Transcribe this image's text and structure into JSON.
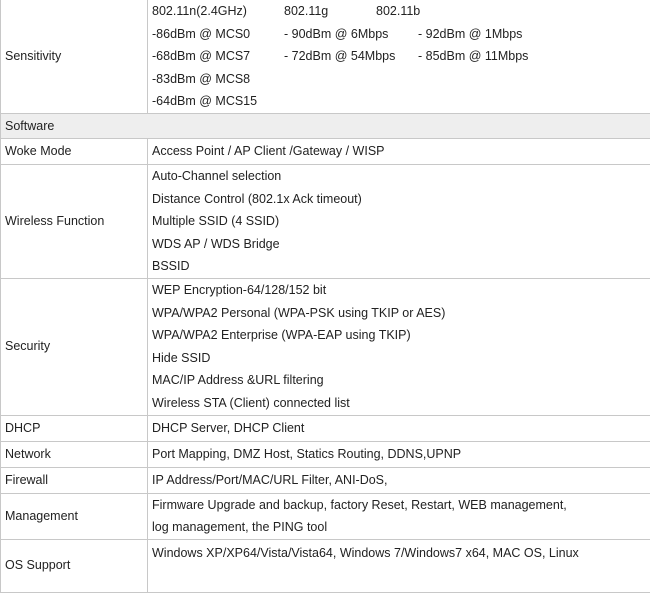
{
  "rows": {
    "sensitivity": {
      "label": "Sensitivity",
      "header": [
        "802.11n(2.4GHz)",
        "802.11g",
        "802.11b"
      ],
      "lines": [
        [
          "-86dBm @ MCS0",
          "- 90dBm @ 6Mbps",
          "- 92dBm @ 1Mbps"
        ],
        [
          "-68dBm @ MCS7",
          "- 72dBm @ 54Mbps",
          "- 85dBm @ 11Mbps"
        ],
        [
          "-83dBm @ MCS8",
          "",
          ""
        ],
        [
          "-64dBm @ MCS15",
          "",
          ""
        ]
      ]
    },
    "software": {
      "label": "Software"
    },
    "work_mode": {
      "label": "Woke Mode",
      "value": "Access Point / AP Client /Gateway / WISP"
    },
    "wireless_function": {
      "label": "Wireless Function",
      "items": [
        "Auto-Channel selection",
        "Distance Control (802.1x Ack timeout)",
        "Multiple SSID (4 SSID)",
        "WDS AP / WDS Bridge",
        "BSSID"
      ]
    },
    "security": {
      "label": "Security",
      "items": [
        "WEP Encryption-64/128/152 bit",
        "WPA/WPA2 Personal (WPA-PSK using TKIP or AES)",
        "WPA/WPA2 Enterprise (WPA-EAP using TKIP)",
        "Hide SSID",
        "MAC/IP Address &URL filtering",
        "Wireless STA (Client) connected list"
      ]
    },
    "dhcp": {
      "label": "DHCP",
      "value": "DHCP Server, DHCP Client"
    },
    "network": {
      "label": "Network",
      "value": "Port Mapping, DMZ Host, Statics Routing, DDNS,UPNP"
    },
    "firewall": {
      "label": "Firewall",
      "value": "IP Address/Port/MAC/URL Filter, ANI-DoS,"
    },
    "management": {
      "label": "Management",
      "items": [
        "Firmware Upgrade and backup, factory Reset, Restart, WEB management,",
        "log management, the PING tool"
      ]
    },
    "os_support": {
      "label": "OS Support",
      "value": "Windows XP/XP64/Vista/Vista64, Windows 7/Windows7 x64, MAC OS, Linux"
    }
  }
}
